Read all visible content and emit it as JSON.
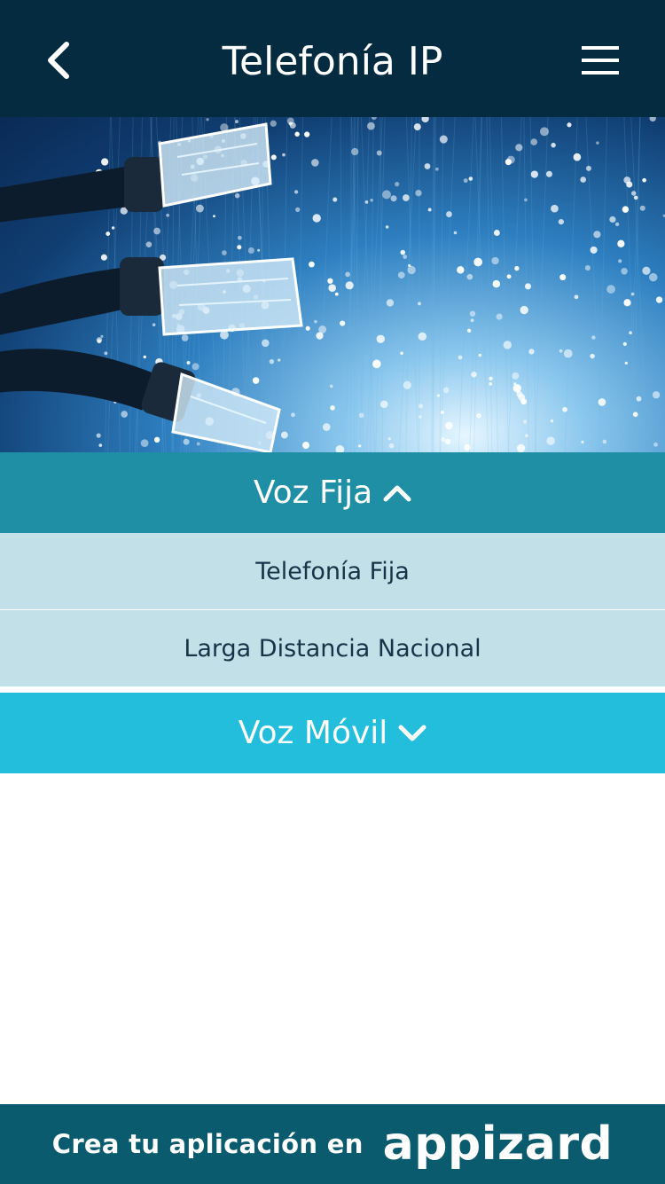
{
  "header": {
    "title": "Telefonía IP",
    "back_icon": "chevron-left-icon",
    "menu_icon": "hamburger-menu-icon"
  },
  "hero": {
    "image": "network-cables-fiber-optic-photo"
  },
  "accordion": {
    "sections": [
      {
        "label": "Voz Fija",
        "state": "expanded",
        "icon": "chevron-up-icon",
        "items": [
          {
            "label": "Telefonía Fija"
          },
          {
            "label": "Larga Distancia Nacional"
          }
        ]
      },
      {
        "label": "Voz Móvil",
        "state": "collapsed",
        "icon": "chevron-down-icon",
        "items": []
      }
    ]
  },
  "footer": {
    "text": "Crea tu aplicación en",
    "brand": "appizard"
  },
  "colors": {
    "header_bg": "#052b40",
    "section_expanded_bg": "#1e8fa4",
    "section_collapsed_bg": "#22bedb",
    "subitem_bg": "#c2e0e8",
    "footer_bg": "#0b5b6f"
  }
}
